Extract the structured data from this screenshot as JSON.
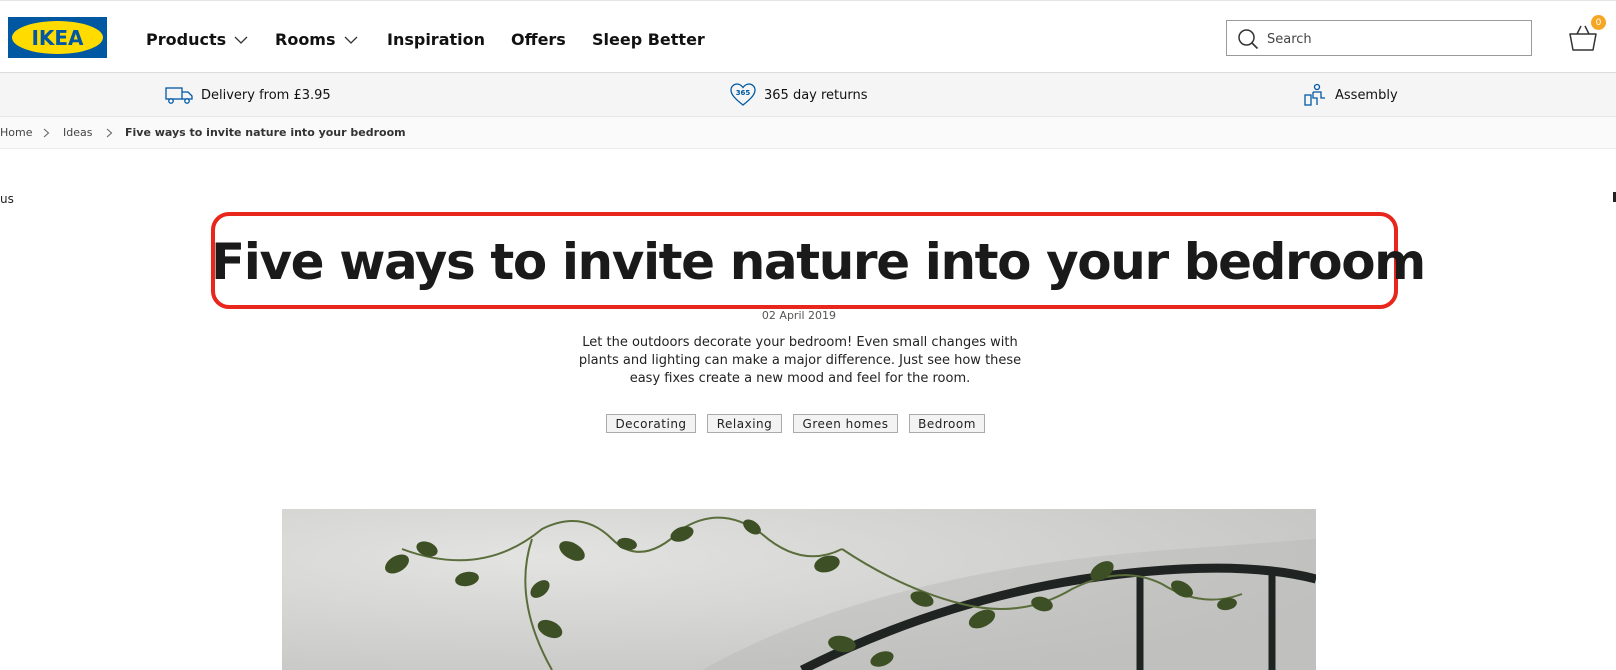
{
  "header": {
    "logo_text": "IKEA",
    "nav": [
      {
        "label": "Products",
        "has_dropdown": true
      },
      {
        "label": "Rooms",
        "has_dropdown": true
      },
      {
        "label": "Inspiration",
        "has_dropdown": false
      },
      {
        "label": "Offers",
        "has_dropdown": false
      },
      {
        "label": "Sleep Better",
        "has_dropdown": false
      }
    ],
    "search": {
      "placeholder": "Search",
      "value": ""
    },
    "cart": {
      "count": "0",
      "icon": "basket-icon"
    }
  },
  "service_bar": {
    "items": [
      {
        "label": "Delivery from £3.95",
        "icon": "truck-icon"
      },
      {
        "label": "365 day returns",
        "icon": "heart-365-icon",
        "icon_text": "365"
      },
      {
        "label": "Assembly",
        "icon": "assembly-icon"
      }
    ]
  },
  "breadcrumb": {
    "items": [
      "Home",
      "Ideas",
      "Five ways to invite nature into your bedroom"
    ]
  },
  "edge_text": "us",
  "article": {
    "title": "Five ways to invite nature into your bedroom",
    "date": "02 April 2019",
    "intro": "Let the outdoors decorate your bedroom! Even small changes with plants and lighting can make a major difference. Just see how these easy fixes create a new mood and feel for the room.",
    "tags": [
      "Decorating",
      "Relaxing",
      "Green homes",
      "Bedroom"
    ]
  },
  "colors": {
    "brand_blue": "#0058a3",
    "brand_yellow": "#ffdb00",
    "highlight_red": "#e8261b",
    "badge_orange": "#f5a623"
  }
}
